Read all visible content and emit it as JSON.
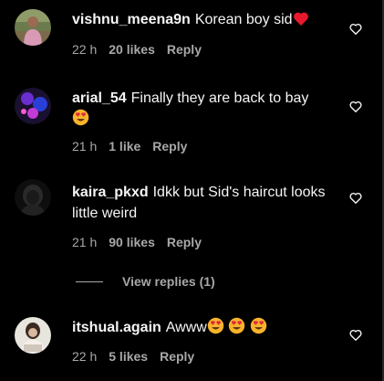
{
  "comments": [
    {
      "username": "vishnu_meena9n",
      "text": "Korean boy sid",
      "emoji": "red-heart",
      "time": "22 h",
      "likes": "20 likes",
      "reply": "Reply"
    },
    {
      "username": "arial_54",
      "text": "Finally they are back to bay",
      "emoji": "heart-eyes",
      "time": "21 h",
      "likes": "1 like",
      "reply": "Reply"
    },
    {
      "username": "kaira_pkxd",
      "text": "Idkk but Sid's haircut looks little weird",
      "time": "21 h",
      "likes": "90 likes",
      "reply": "Reply",
      "view_replies": "View replies (1)"
    },
    {
      "username": "itshual.again",
      "text": "Awww",
      "emoji": "heart-eyes x3",
      "time": "22 h",
      "likes": "5 likes",
      "reply": "Reply"
    }
  ],
  "colors": {
    "background": "#000000",
    "primary_text": "#f5f5f5",
    "secondary_text": "#a8a8a8",
    "heart_red": "#ff3040"
  },
  "icons": {
    "like_button": "heart-outline-icon",
    "heart_emoji": "red-heart-emoji-icon",
    "heart_eyes_emoji": "heart-eyes-emoji-icon"
  }
}
